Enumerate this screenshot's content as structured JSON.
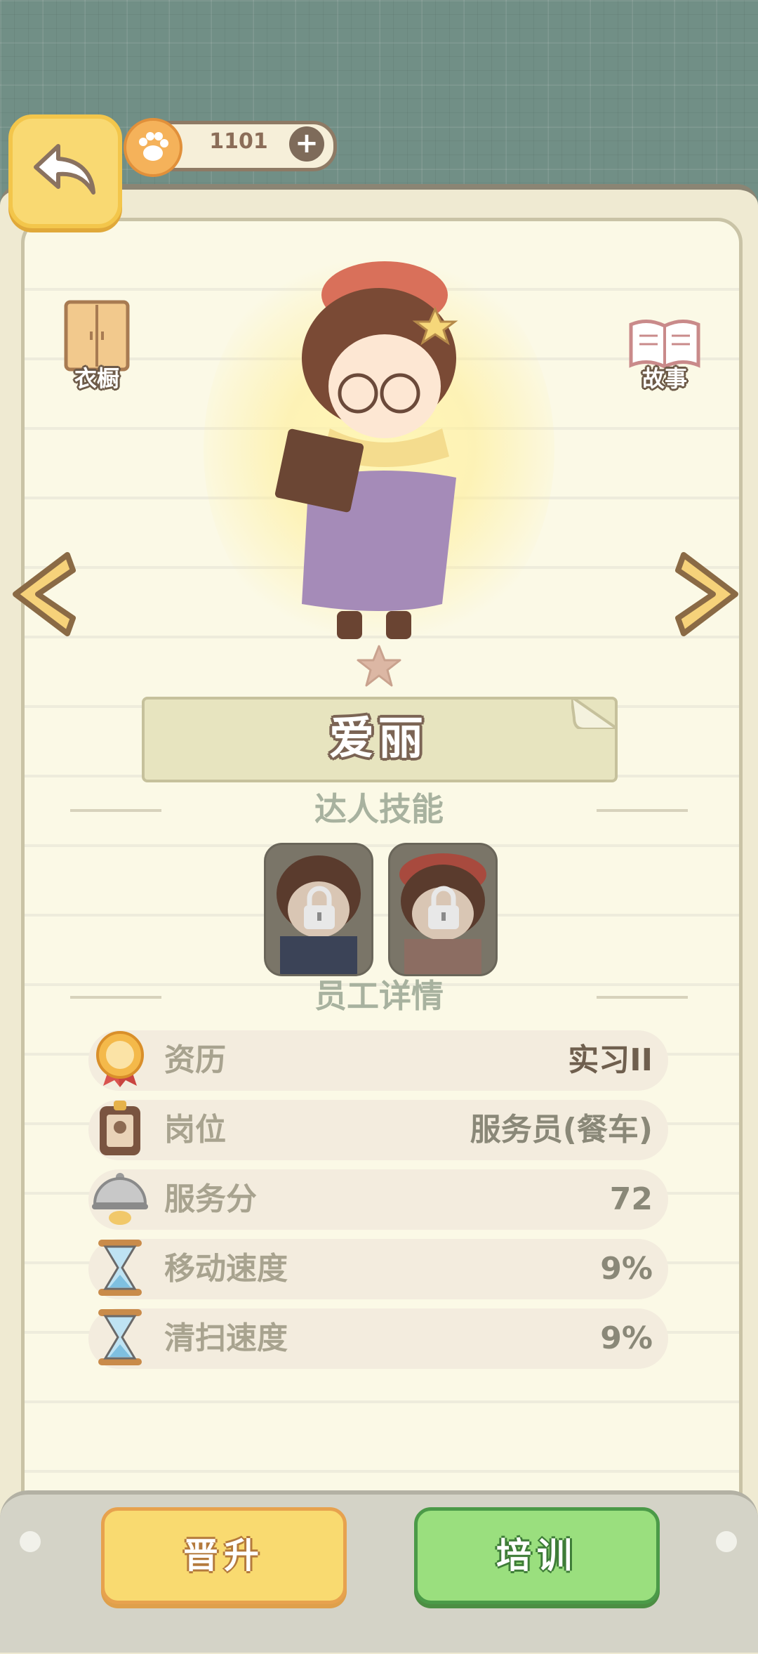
{
  "header": {
    "coins": "1101",
    "back_icon": "back-arrow-icon",
    "paw_icon": "paw-coin-icon",
    "plus_icon": "plus-icon"
  },
  "side_buttons": {
    "wardrobe_label": "衣橱",
    "story_label": "故事"
  },
  "character": {
    "name": "爱丽",
    "star_icon": "star-icon"
  },
  "sections": {
    "skills_title": "达人技能",
    "details_title": "员工详情"
  },
  "skills": [
    {
      "locked": true,
      "icon": "lock-icon"
    },
    {
      "locked": true,
      "icon": "lock-icon"
    }
  ],
  "stats": [
    {
      "label": "资历",
      "value": "实习II",
      "icon": "medal-icon"
    },
    {
      "label": "岗位",
      "value": "服务员(餐车)",
      "icon": "badge-icon"
    },
    {
      "label": "服务分",
      "value": "72",
      "icon": "cloche-icon"
    },
    {
      "label": "移动速度",
      "value": "9%",
      "icon": "hourglass-icon"
    },
    {
      "label": "清扫速度",
      "value": "9%",
      "icon": "hourglass-icon"
    }
  ],
  "actions": {
    "promote_label": "晋升",
    "train_label": "培训"
  },
  "colors": {
    "accent_yellow": "#f9da70",
    "accent_green": "#9adf7e",
    "paper": "#fbf9e6"
  }
}
